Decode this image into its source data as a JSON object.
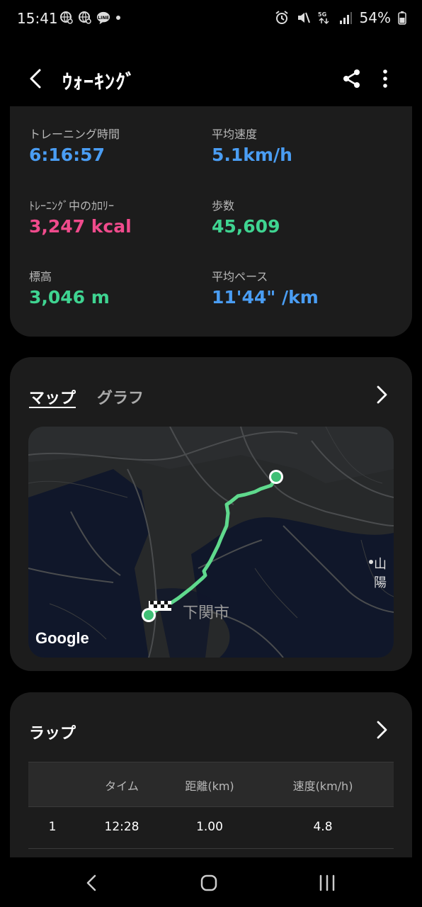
{
  "status_bar": {
    "time": "15:41",
    "battery": "54%",
    "left_icons": [
      "globe-search-icon",
      "globe-search-icon",
      "line-app-icon",
      "dot-icon"
    ],
    "right_icons": [
      "alarm-icon",
      "mute-icon",
      "5g-icon",
      "signal-icon",
      "battery-icon"
    ]
  },
  "app_bar": {
    "title": "ｳｫｰｷﾝｸﾞ"
  },
  "stats": [
    {
      "label": "トレーニング時間",
      "value": "6:16:57",
      "color": "#4a9df3"
    },
    {
      "label": "平均速度",
      "value": "5.1km/h",
      "color": "#4a9df3"
    },
    {
      "label": "ﾄﾚｰﾆﾝｸﾞ中のｶﾛﾘｰ",
      "value": "3,247 kcal",
      "color": "#f04b8c"
    },
    {
      "label": "歩数",
      "value": "45,609",
      "color": "#3fd491"
    },
    {
      "label": "標高",
      "value": "3,046 m",
      "color": "#3fd491"
    },
    {
      "label": "平均ペース",
      "value": "11'44\" /km",
      "color": "#4a9df3"
    }
  ],
  "map_card": {
    "tabs": [
      "マップ",
      "グラフ"
    ],
    "active_tab": "マップ",
    "google_label": "Google",
    "city_label": "下関市",
    "city_label_2": "山陽",
    "route_color": "#5fd98d"
  },
  "laps": {
    "title": "ラップ",
    "columns": [
      "",
      "タイム",
      "距離(km)",
      "速度(km/h)"
    ],
    "rows": [
      {
        "lap": "1",
        "time": "12:28",
        "distance": "1.00",
        "speed": "4.8"
      }
    ]
  }
}
